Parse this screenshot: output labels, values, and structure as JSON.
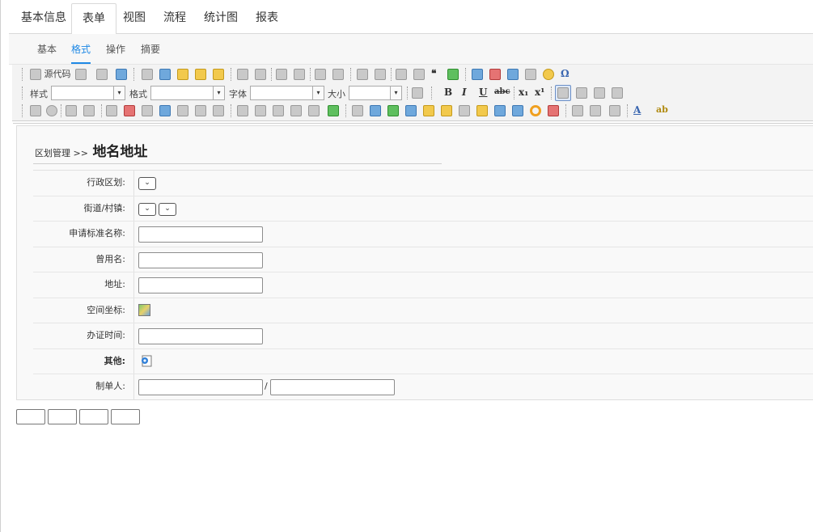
{
  "top_tabs": [
    {
      "label": "基本信息",
      "active": false
    },
    {
      "label": "表单",
      "active": true
    },
    {
      "label": "视图",
      "active": false
    },
    {
      "label": "流程",
      "active": false
    },
    {
      "label": "统计图",
      "active": false
    },
    {
      "label": "报表",
      "active": false
    }
  ],
  "sub_tabs": [
    {
      "label": "基本",
      "active": false
    },
    {
      "label": "格式",
      "active": true
    },
    {
      "label": "操作",
      "active": false
    },
    {
      "label": "摘要",
      "active": false
    }
  ],
  "toolbar": {
    "source_label": "源代码",
    "style_label": "样式",
    "format_label": "格式",
    "font_label": "字体",
    "size_label": "大小",
    "bold_label": "B",
    "italic_label": "I",
    "underline_label": "U",
    "strike_label": "abc",
    "subscript_label": "x₁",
    "superscript_label": "x¹",
    "omega_label": "Ω",
    "quote_label": "❝",
    "text_color_label": "A",
    "bg_color_label": "ab"
  },
  "form": {
    "breadcrumb_parent": "区划管理",
    "breadcrumb_sep": ">>",
    "title": "地名地址",
    "fields": {
      "district": "行政区划:",
      "street": "街道/村镇:",
      "std_name": "申请标准名称:",
      "common_name": "曾用名:",
      "address": "地址:",
      "coords": "空间坐标:",
      "issue_time": "办证时间:",
      "other": "其他:",
      "creator": "制单人:"
    },
    "creator_sep": "/"
  }
}
